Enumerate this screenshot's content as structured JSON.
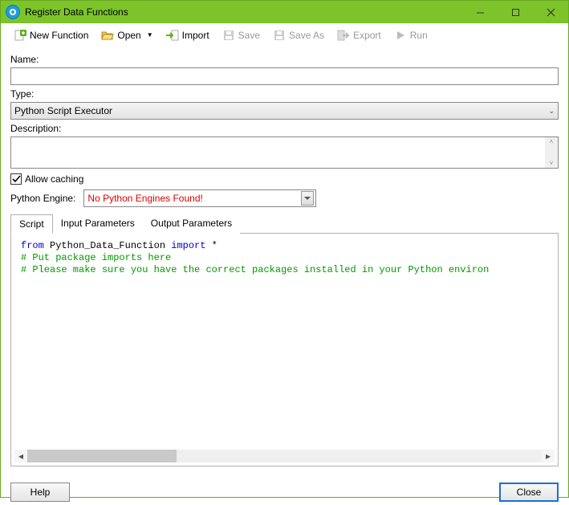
{
  "window": {
    "title": "Register Data Functions"
  },
  "toolbar": {
    "newFunction": "New Function",
    "open": "Open",
    "import": "Import",
    "save": "Save",
    "saveAs": "Save As",
    "export": "Export",
    "run": "Run"
  },
  "form": {
    "nameLabel": "Name:",
    "nameValue": "",
    "typeLabel": "Type:",
    "typeValue": "Python Script Executor",
    "descLabel": "Description:",
    "descValue": "",
    "allowCaching": "Allow caching",
    "engineLabel": "Python Engine:",
    "engineValue": "No Python Engines Found!"
  },
  "tabs": {
    "script": "Script",
    "inputParams": "Input Parameters",
    "outputParams": "Output Parameters"
  },
  "code": {
    "line1a": "from",
    "line1b": " Python_Data_Function ",
    "line1c": "import",
    "line1d": " *",
    "line2": "# Put package imports here",
    "line3": "# Please make sure you have the correct packages installed in your Python environ"
  },
  "footer": {
    "help": "Help",
    "close": "Close"
  }
}
